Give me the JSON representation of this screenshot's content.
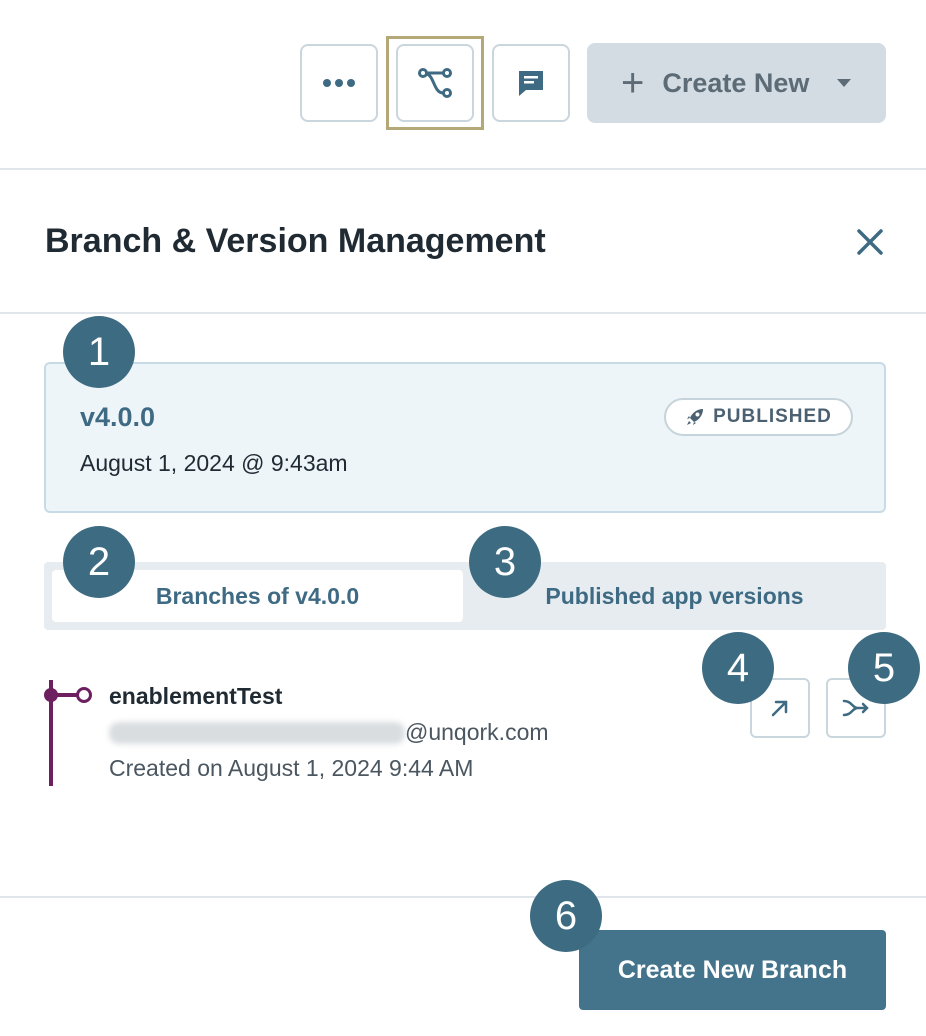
{
  "toolbar": {
    "more_icon": "more-dots-icon",
    "branch_icon": "branch-icon",
    "comment_icon": "comment-icon",
    "create_new_label": "Create New",
    "colors": {
      "accent": "#3e6b83",
      "active_frame": "#b5a878"
    }
  },
  "panel": {
    "title": "Branch & Version Management"
  },
  "version": {
    "name": "v4.0.0",
    "date": "August 1, 2024 @ 9:43am",
    "status_badge": "PUBLISHED"
  },
  "tabs": [
    {
      "label": "Branches of v4.0.0",
      "active": true
    },
    {
      "label": "Published app versions",
      "active": false
    }
  ],
  "branches": [
    {
      "name": "enablementTest",
      "email_domain": "@unqork.com",
      "created": "Created on August 1, 2024 9:44 AM",
      "branch_color": "#6e1f5f"
    }
  ],
  "footer": {
    "create_branch_label": "Create New Branch",
    "button_color": "#44748c"
  },
  "callouts": [
    "1",
    "2",
    "3",
    "4",
    "5",
    "6"
  ]
}
